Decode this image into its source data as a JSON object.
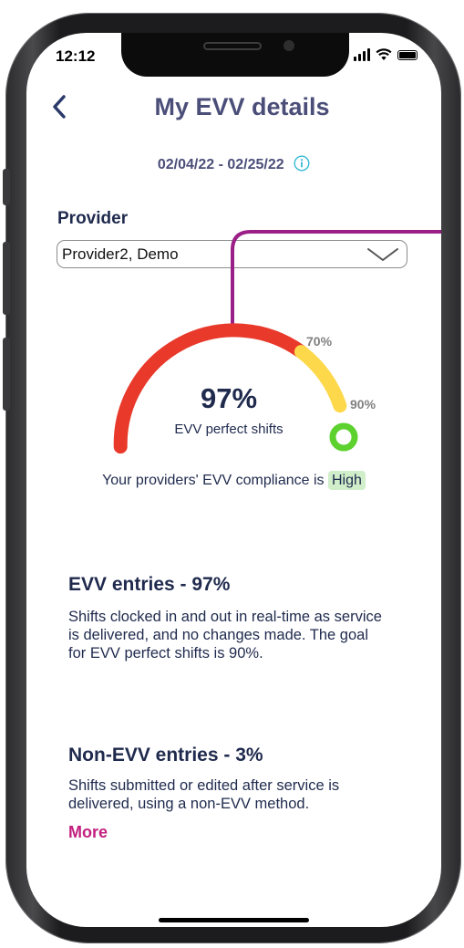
{
  "status_bar": {
    "time": "12:12"
  },
  "header": {
    "title": "My EVV details"
  },
  "date_range": "02/04/22 - 02/25/22",
  "provider": {
    "label": "Provider",
    "selected": "Provider2, Demo"
  },
  "gauge": {
    "value_label": "97%",
    "value": 97,
    "caption": "EVV perfect shifts",
    "ticks": [
      "70%",
      "90%"
    ],
    "zone_colors": {
      "low": "#e8392a",
      "medium": "#fdd84b",
      "high": "#5dd12e"
    }
  },
  "compliance": {
    "text": "Your providers' EVV compliance is",
    "level": "High"
  },
  "sections": [
    {
      "title": "EVV entries - 97%",
      "text": "Shifts clocked in and out in real-time as service is delivered, and no changes made. The goal for EVV perfect shifts is 90%."
    },
    {
      "title": "Non-EVV entries - 3%",
      "text": "Shifts submitted or edited after service is delivered, using a non-EVV method."
    }
  ],
  "more_link": "More",
  "colors": {
    "accent": "#4b4e78",
    "link": "#c2207f",
    "callout": "#9a1f86",
    "info": "#35b9d6"
  },
  "icons": [
    "back-chevron-icon",
    "info-icon",
    "chevron-down-icon",
    "signal-icon",
    "wifi-icon",
    "battery-icon"
  ]
}
